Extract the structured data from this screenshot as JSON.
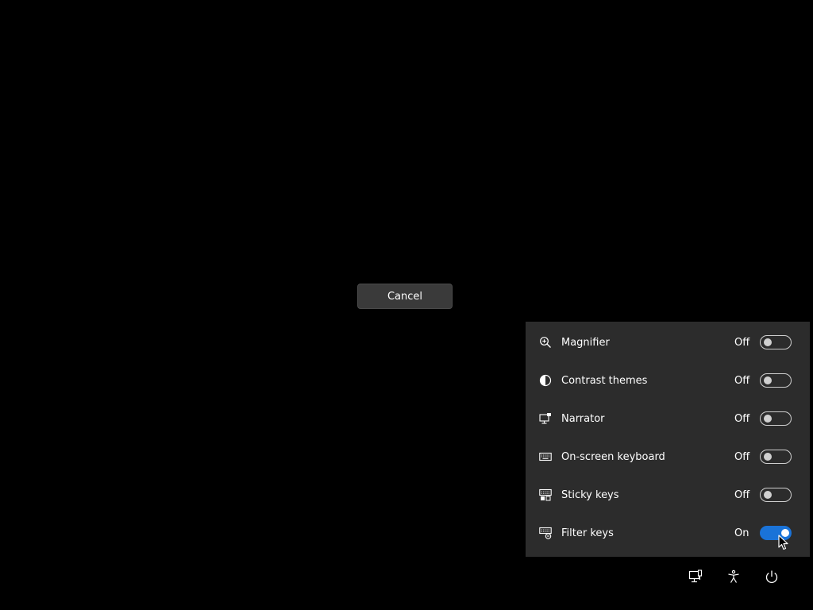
{
  "dialog": {
    "cancel_label": "Cancel"
  },
  "accessibility_flyout": {
    "items": [
      {
        "label": "Magnifier",
        "state": "Off",
        "on": false,
        "icon": "magnifier-icon"
      },
      {
        "label": "Contrast themes",
        "state": "Off",
        "on": false,
        "icon": "contrast-icon"
      },
      {
        "label": "Narrator",
        "state": "Off",
        "on": false,
        "icon": "narrator-icon"
      },
      {
        "label": "On-screen keyboard",
        "state": "Off",
        "on": false,
        "icon": "keyboard-icon"
      },
      {
        "label": "Sticky keys",
        "state": "Off",
        "on": false,
        "icon": "sticky-keys-icon"
      },
      {
        "label": "Filter keys",
        "state": "On",
        "on": true,
        "icon": "filter-keys-icon"
      }
    ]
  },
  "taskbar": {
    "icons": [
      "network-icon",
      "accessibility-icon",
      "power-icon"
    ]
  },
  "colors": {
    "background": "#000000",
    "flyout_bg": "#2c2c2c",
    "toggle_on": "#1a73d8"
  }
}
